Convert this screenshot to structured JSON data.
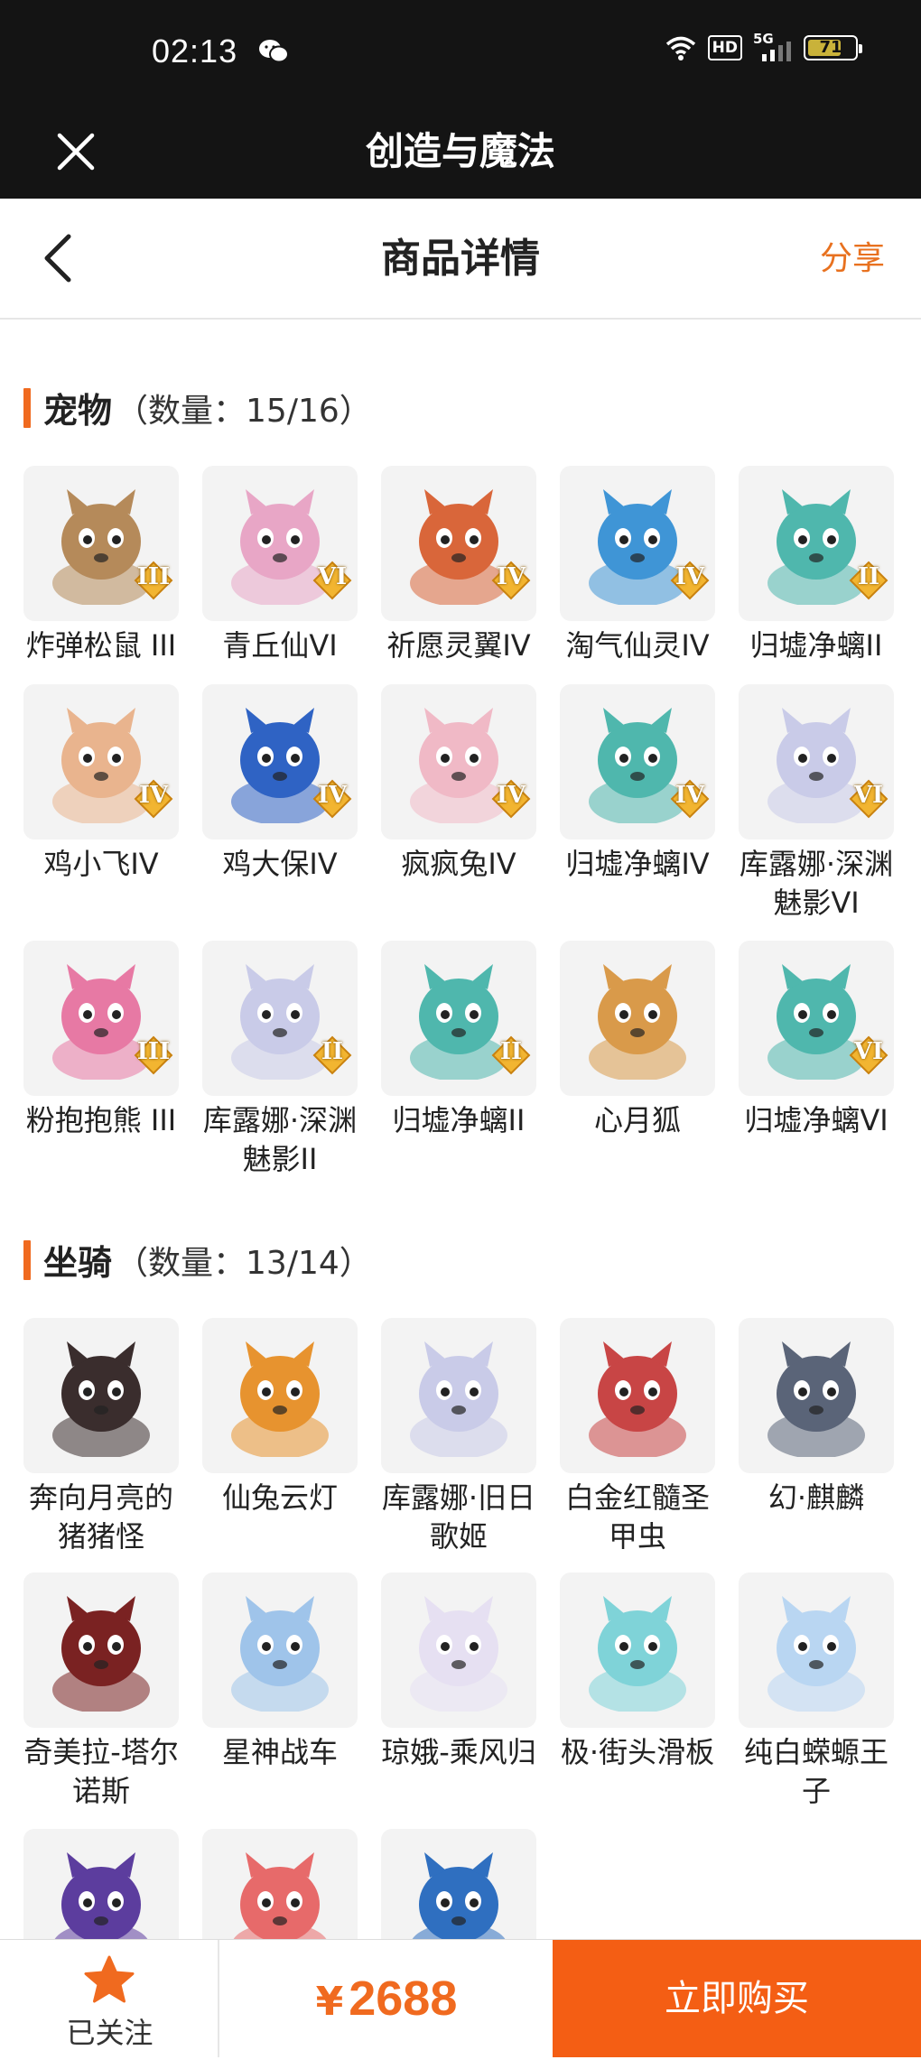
{
  "status_bar": {
    "time": "02:13",
    "hd_badge": "HD",
    "network": "5G",
    "battery": "71",
    "battery_level": 0.71
  },
  "app_bar": {
    "title": "创造与魔法"
  },
  "nav": {
    "title": "商品详情",
    "share_label": "分享"
  },
  "pets": {
    "title": "宠物",
    "count": "（数量：15/16）",
    "items": [
      {
        "name": "炸弹松鼠 III",
        "tier": "III",
        "icon": "squirrel-art",
        "color": "#b58a5a"
      },
      {
        "name": "青丘仙VI",
        "tier": "VI",
        "icon": "fox-fairy-art",
        "color": "#e8a6c6"
      },
      {
        "name": "祈愿灵翼IV",
        "tier": "IV",
        "icon": "phoenix-art",
        "color": "#d9663a"
      },
      {
        "name": "淘气仙灵IV",
        "tier": "IV",
        "icon": "blue-pup-art",
        "color": "#3f95d6"
      },
      {
        "name": "归墟净螭II",
        "tier": "II",
        "icon": "dragon-art",
        "color": "#4fb7ad"
      },
      {
        "name": "鸡小飞IV",
        "tier": "IV",
        "icon": "chick-art",
        "color": "#e9b48e"
      },
      {
        "name": "鸡大保IV",
        "tier": "IV",
        "icon": "blue-bird-art",
        "color": "#2f63c4"
      },
      {
        "name": "疯疯兔IV",
        "tier": "IV",
        "icon": "rabbit-art",
        "color": "#f0b9c6"
      },
      {
        "name": "归墟净螭IV",
        "tier": "IV",
        "icon": "dragon-art",
        "color": "#4fb7ad"
      },
      {
        "name": "库露娜·深渊魅影VI",
        "tier": "VI",
        "icon": "kuluna-art",
        "color": "#c9cbe8"
      },
      {
        "name": "粉抱抱熊 III",
        "tier": "III",
        "icon": "pink-bear-art",
        "color": "#e779a4"
      },
      {
        "name": "库露娜·深渊魅影II",
        "tier": "II",
        "icon": "kuluna-art",
        "color": "#c9cbe8"
      },
      {
        "name": "归墟净螭II",
        "tier": "II",
        "icon": "dragon-art",
        "color": "#4fb7ad"
      },
      {
        "name": "心月狐",
        "tier": "",
        "icon": "moon-fox-art",
        "color": "#d99a4a"
      },
      {
        "name": "归墟净螭VI",
        "tier": "VI",
        "icon": "dragon-art",
        "color": "#4fb7ad"
      }
    ]
  },
  "mounts": {
    "title": "坐骑",
    "count": "（数量：13/14）",
    "items": [
      {
        "name": "奔向月亮的猪猪怪",
        "icon": "pig-art",
        "color": "#3a2d2d"
      },
      {
        "name": "仙兔云灯",
        "icon": "lantern-rabbit-art",
        "color": "#e7932f"
      },
      {
        "name": "库露娜·旧日歌姬",
        "icon": "kuluna-art",
        "color": "#c9cbe8"
      },
      {
        "name": "白金红髓圣甲虫",
        "icon": "beetle-art",
        "color": "#c84545"
      },
      {
        "name": "幻·麒麟",
        "icon": "qilin-art",
        "color": "#5a6478"
      },
      {
        "name": "奇美拉-塔尔诺斯",
        "icon": "chimera-art",
        "color": "#7a2222"
      },
      {
        "name": "星神战车",
        "icon": "star-horse-art",
        "color": "#9fc4ea"
      },
      {
        "name": "琼娥-乘风归",
        "icon": "qiong-e-art",
        "color": "#e6e0f2"
      },
      {
        "name": "极·街头滑板",
        "icon": "skateboard-art",
        "color": "#7fd3d8"
      },
      {
        "name": "纯白蝾螈王子",
        "icon": "axolotl-art",
        "color": "#b9d6f2"
      },
      {
        "name": "",
        "icon": "purple-dino-art",
        "color": "#5c3d9e"
      },
      {
        "name": "",
        "icon": "red-fox-art",
        "color": "#e76a6a"
      },
      {
        "name": "",
        "icon": "blue-dragon-art",
        "color": "#2f6fc0"
      }
    ]
  },
  "bottom_bar": {
    "follow_label": "已关注",
    "price_symbol": "¥",
    "price": "2688",
    "buy_label": "立即购买"
  }
}
